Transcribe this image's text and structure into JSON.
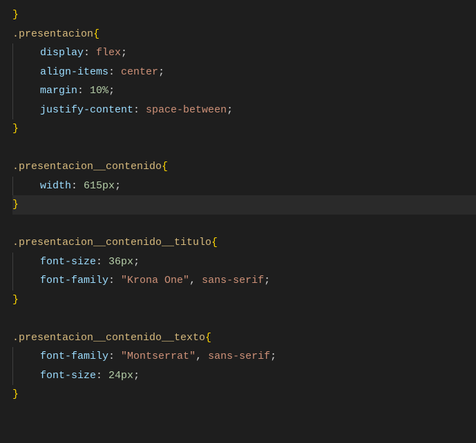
{
  "rules": [
    {
      "selector": null,
      "lines": [
        {
          "type": "close"
        }
      ]
    },
    {
      "selector": ".presentacion",
      "lines": [
        {
          "prop": "display",
          "tokens": [
            {
              "t": "value",
              "v": "flex"
            }
          ]
        },
        {
          "prop": "align-items",
          "tokens": [
            {
              "t": "value",
              "v": "center"
            }
          ]
        },
        {
          "prop": "margin",
          "tokens": [
            {
              "t": "num",
              "v": "10"
            },
            {
              "t": "unit",
              "v": "%"
            }
          ]
        },
        {
          "prop": "justify-content",
          "tokens": [
            {
              "t": "value",
              "v": "space-between"
            }
          ]
        }
      ]
    },
    {
      "selector": ".presentacion__contenido",
      "highlightClose": true,
      "lines": [
        {
          "prop": "width",
          "tokens": [
            {
              "t": "num",
              "v": "615"
            },
            {
              "t": "unit",
              "v": "px"
            }
          ]
        }
      ]
    },
    {
      "selector": ".presentacion__contenido__titulo",
      "lines": [
        {
          "prop": "font-size",
          "tokens": [
            {
              "t": "num",
              "v": "36"
            },
            {
              "t": "unit",
              "v": "px"
            }
          ]
        },
        {
          "prop": "font-family",
          "tokens": [
            {
              "t": "string",
              "v": "\"Krona One\""
            },
            {
              "t": "comma",
              "v": ", "
            },
            {
              "t": "value",
              "v": "sans-serif"
            }
          ]
        }
      ]
    },
    {
      "selector": ".presentacion__contenido__texto",
      "lines": [
        {
          "prop": "font-family",
          "tokens": [
            {
              "t": "string",
              "v": "\"Montserrat\""
            },
            {
              "t": "comma",
              "v": ", "
            },
            {
              "t": "value",
              "v": "sans-serif"
            }
          ]
        },
        {
          "prop": "font-size",
          "tokens": [
            {
              "t": "num",
              "v": "24"
            },
            {
              "t": "unit",
              "v": "px"
            }
          ]
        }
      ]
    }
  ]
}
